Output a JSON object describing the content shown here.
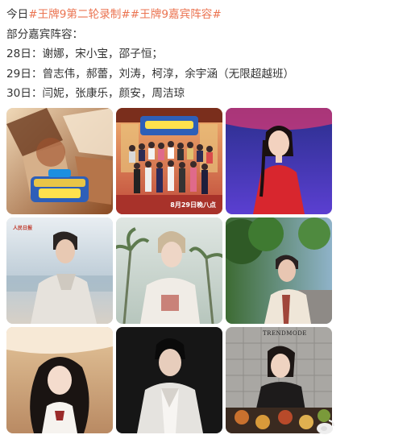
{
  "post": {
    "line1_prefix": "今日",
    "hashtag1": "#王牌9第二轮录制#",
    "hashtag2": "#王牌9嘉宾阵容#",
    "line2": "部分嘉宾阵容：",
    "line3": "28日：谢娜，宋小宝，邵子恒；",
    "line4": "29日：曾志伟，郝蕾，刘涛，柯淳，余宇涵（无限超越班）",
    "line5": "30日：闫妮，张康乐，颜安，周洁琼"
  },
  "images": {
    "img2_date": "8月29日晚八点",
    "img4_logo": "人民日报",
    "img9_magazine": "TRENDMODE"
  },
  "watermark": {
    "label": "",
    "icon": "weibo-logo-icon"
  },
  "colors": {
    "hashtag": "#eb7350",
    "text": "#333333"
  }
}
